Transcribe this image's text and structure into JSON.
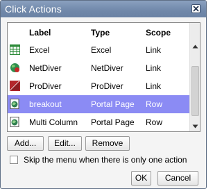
{
  "window": {
    "title": "Click Actions"
  },
  "table": {
    "columns": {
      "label": "Label",
      "type": "Type",
      "scope": "Scope"
    },
    "rows": [
      {
        "label": "Excel",
        "type": "Excel",
        "scope": "Link",
        "icon": "excel-icon",
        "selected": false
      },
      {
        "label": "NetDiver",
        "type": "NetDiver",
        "scope": "Link",
        "icon": "netdiver-icon",
        "selected": false
      },
      {
        "label": "ProDiver",
        "type": "ProDiver",
        "scope": "Link",
        "icon": "prodiver-icon",
        "selected": false
      },
      {
        "label": "breakout",
        "type": "Portal Page",
        "scope": "Row",
        "icon": "portal-page-icon",
        "selected": true
      },
      {
        "label": "Multi Column",
        "type": "Portal Page",
        "scope": "Row",
        "icon": "portal-page-icon",
        "selected": false
      }
    ]
  },
  "actions": {
    "add": "Add...",
    "edit": "Edit...",
    "remove": "Remove"
  },
  "option": {
    "label": "Skip the menu when there is only one action",
    "checked": false
  },
  "footer": {
    "ok": "OK",
    "cancel": "Cancel"
  }
}
